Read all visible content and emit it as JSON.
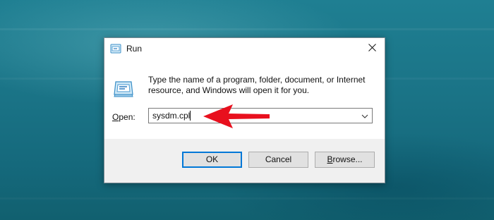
{
  "dialog": {
    "title": "Run",
    "description": "Type the name of a program, folder, document, or Internet resource, and Windows will open it for you.",
    "open_label_underlined": "O",
    "open_label_rest": "pen:",
    "open_value": "sysdm.cpl"
  },
  "buttons": {
    "ok": "OK",
    "cancel": "Cancel",
    "browse_underlined": "B",
    "browse_rest": "rowse..."
  },
  "icons": {
    "title": "run-icon",
    "large": "run-icon",
    "close": "close-icon",
    "dropdown": "chevron-down-icon",
    "annotation": "red-arrow-icon"
  },
  "colors": {
    "default_button_border": "#0078d7",
    "annotation_arrow": "#e8101e",
    "background": "#1a7386"
  }
}
